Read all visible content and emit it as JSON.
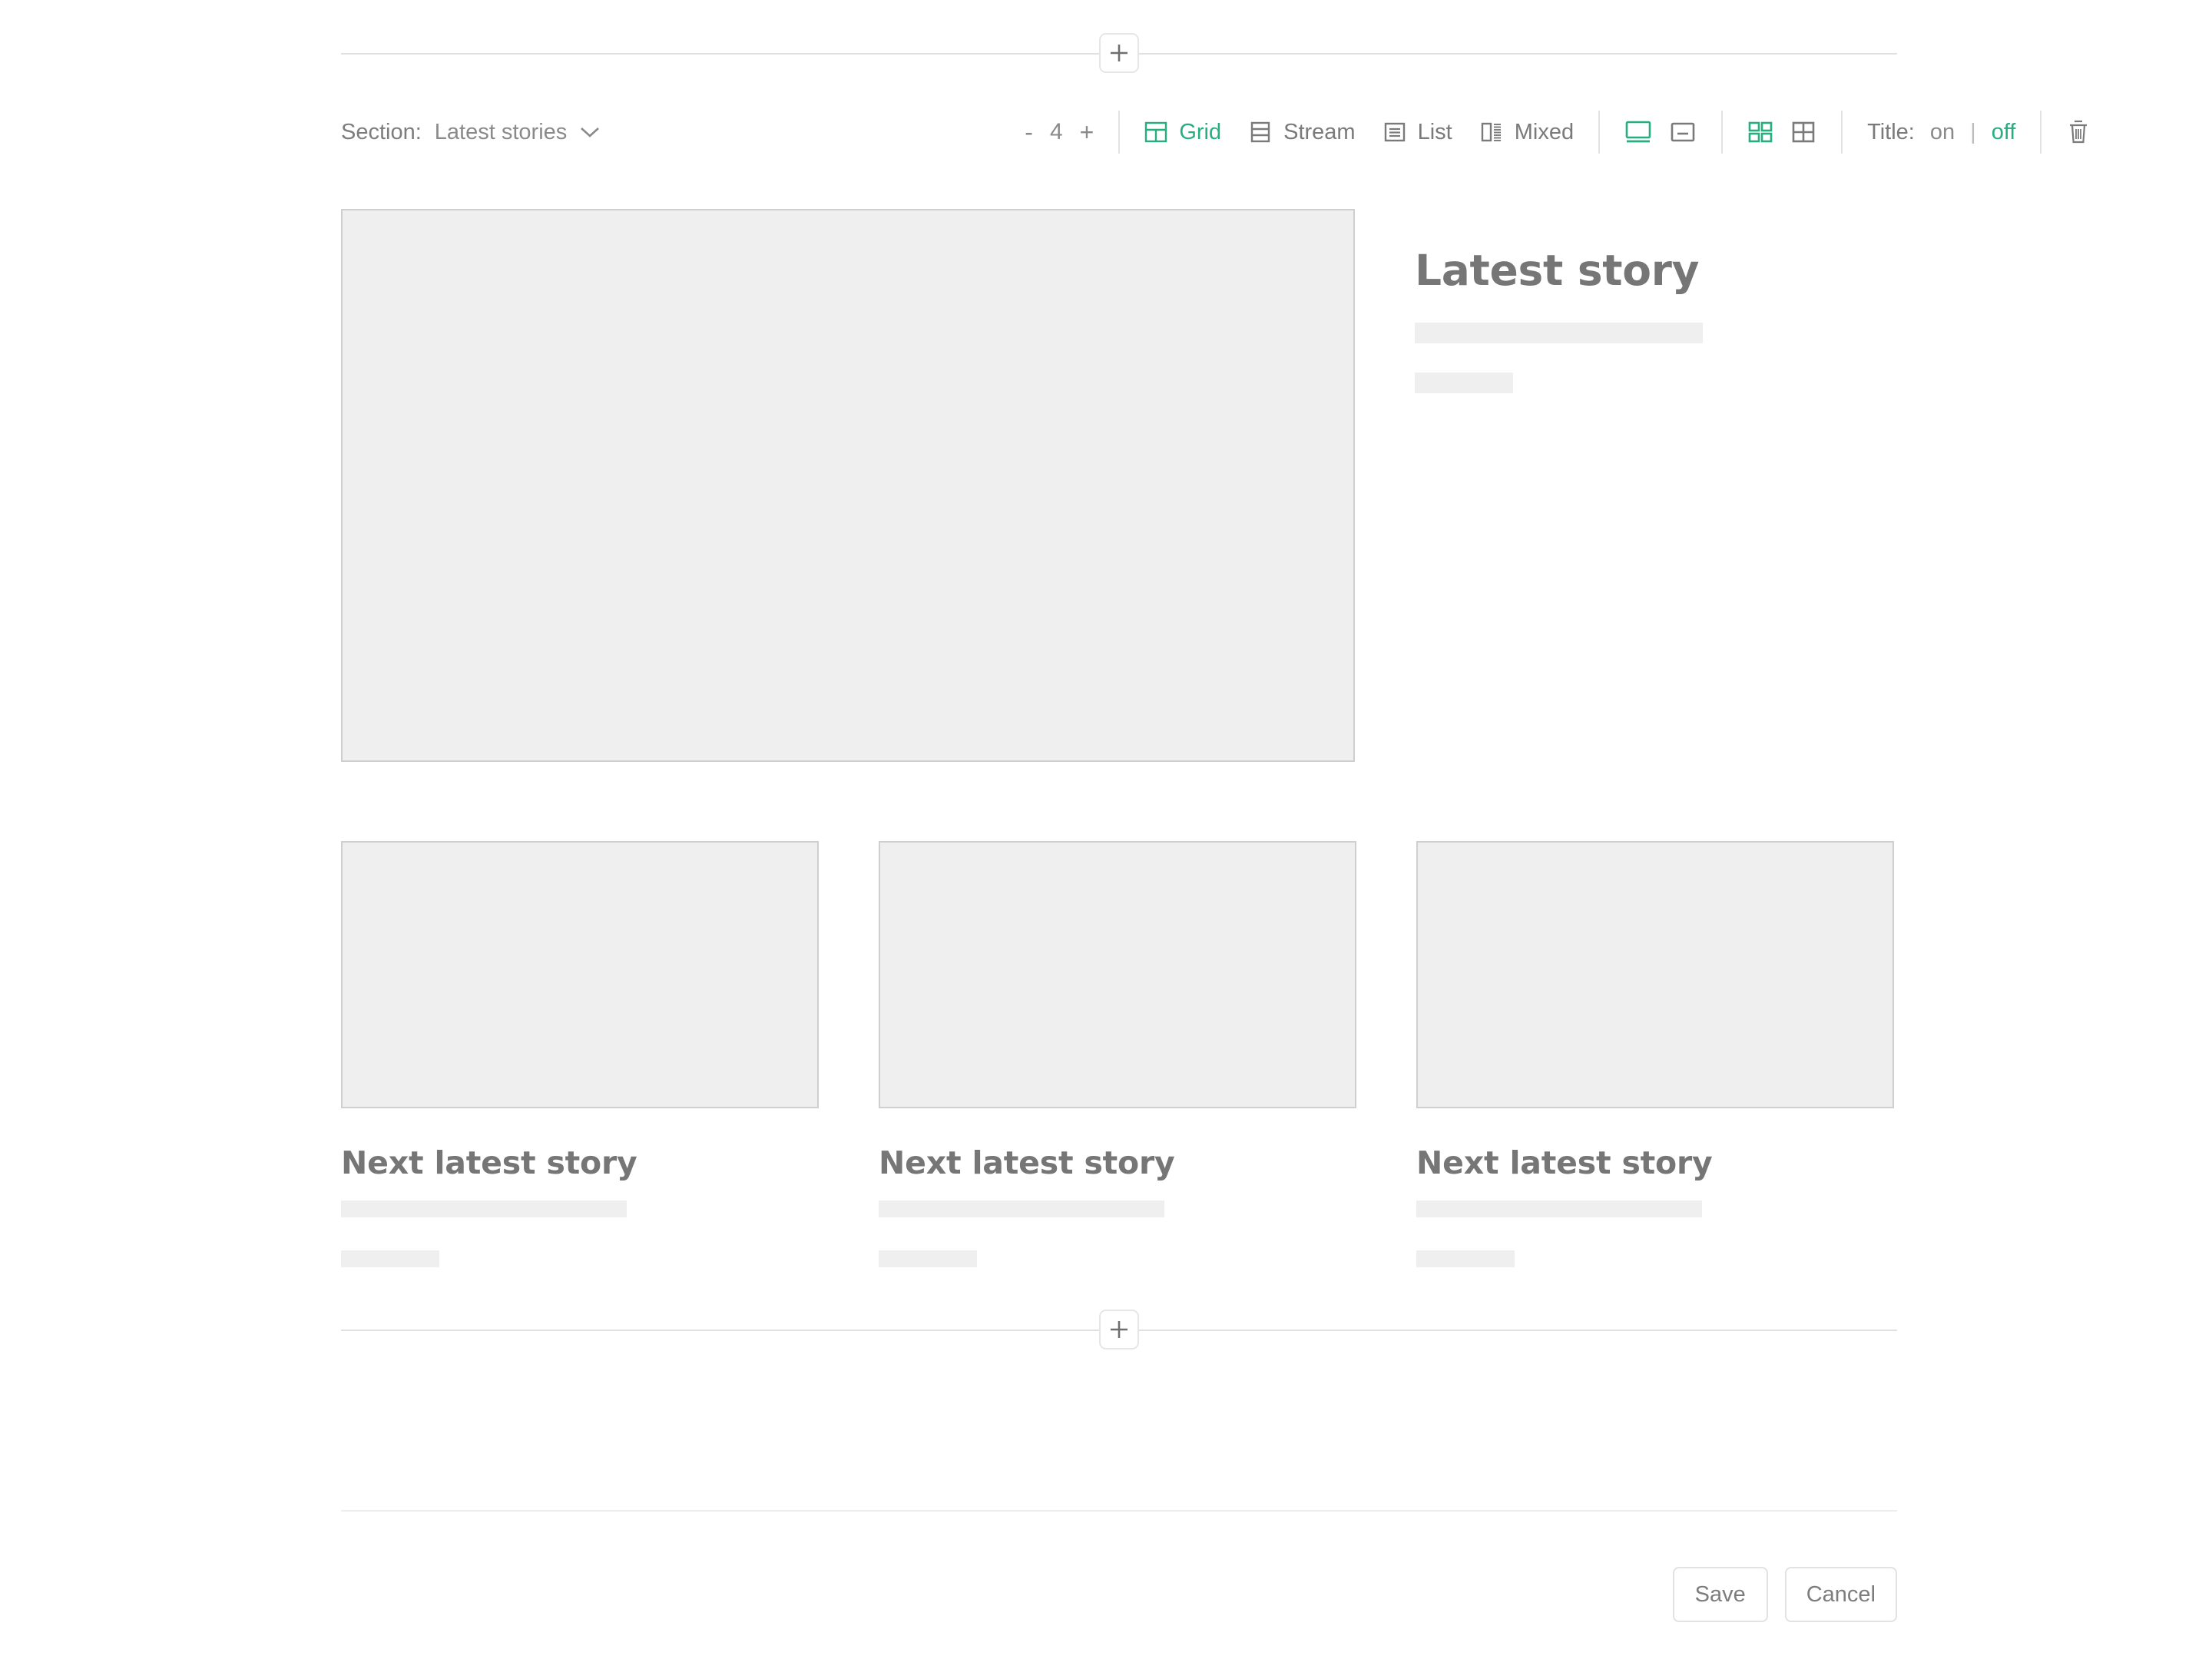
{
  "toolbar": {
    "section_label": "Section:",
    "section_value": "Latest stories",
    "chevron_icon": "chevron-down-icon",
    "counter": {
      "decrement": "-",
      "value": "4",
      "increment": "+"
    },
    "modes": [
      {
        "label": "Grid",
        "icon": "grid-layout-icon",
        "active": true
      },
      {
        "label": "Stream",
        "icon": "stream-layout-icon",
        "active": false
      },
      {
        "label": "List",
        "icon": "list-layout-icon",
        "active": false
      },
      {
        "label": "Mixed",
        "icon": "mixed-layout-icon",
        "active": false
      }
    ],
    "width_toggles": [
      {
        "icon": "full-width-icon",
        "active": true
      },
      {
        "icon": "boxed-width-icon",
        "active": false
      }
    ],
    "density_toggles": [
      {
        "icon": "separated-tiles-icon",
        "active": true
      },
      {
        "icon": "joined-tiles-icon",
        "active": false
      }
    ],
    "title_toggle": {
      "label": "Title:",
      "on": "on",
      "separator": "|",
      "off": "off",
      "selected": "off"
    },
    "delete_icon": "trash-icon",
    "accent_color": "#27ae7f",
    "muted_color": "#7a7a7a"
  },
  "add_buttons": {
    "top": {
      "icon": "plus-icon",
      "label": "+"
    },
    "bottom": {
      "icon": "plus-icon",
      "label": "+"
    }
  },
  "preview": {
    "hero": {
      "title": "Latest story",
      "thumbnail": "image-placeholder"
    },
    "cards": [
      {
        "title": "Next latest story",
        "thumbnail": "image-placeholder"
      },
      {
        "title": "Next latest story",
        "thumbnail": "image-placeholder"
      },
      {
        "title": "Next latest story",
        "thumbnail": "image-placeholder"
      }
    ]
  },
  "footer": {
    "save_label": "Save",
    "cancel_label": "Cancel"
  }
}
